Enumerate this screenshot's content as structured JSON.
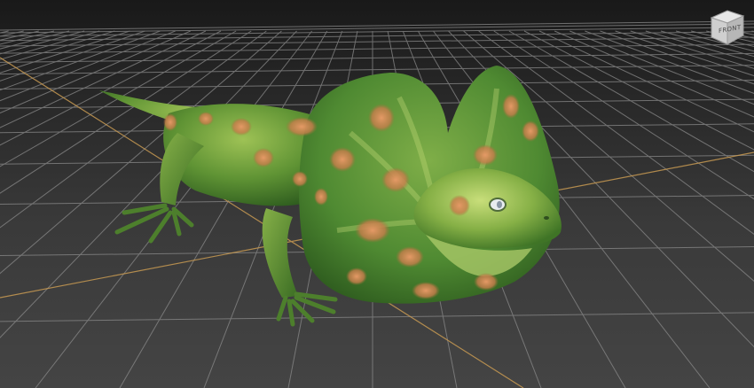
{
  "viewport": {
    "background_top": "#191919",
    "background_bottom": "#444444",
    "grid_color": "#8a8a8a",
    "axis_color": "#c89a52"
  },
  "viewcube": {
    "front_label": "FRONT",
    "icon": "viewcube-icon"
  },
  "model": {
    "icon": "frilled-lizard-3d-model",
    "skin_color": "#6a9a3a",
    "spot_color": "#d98a55"
  }
}
